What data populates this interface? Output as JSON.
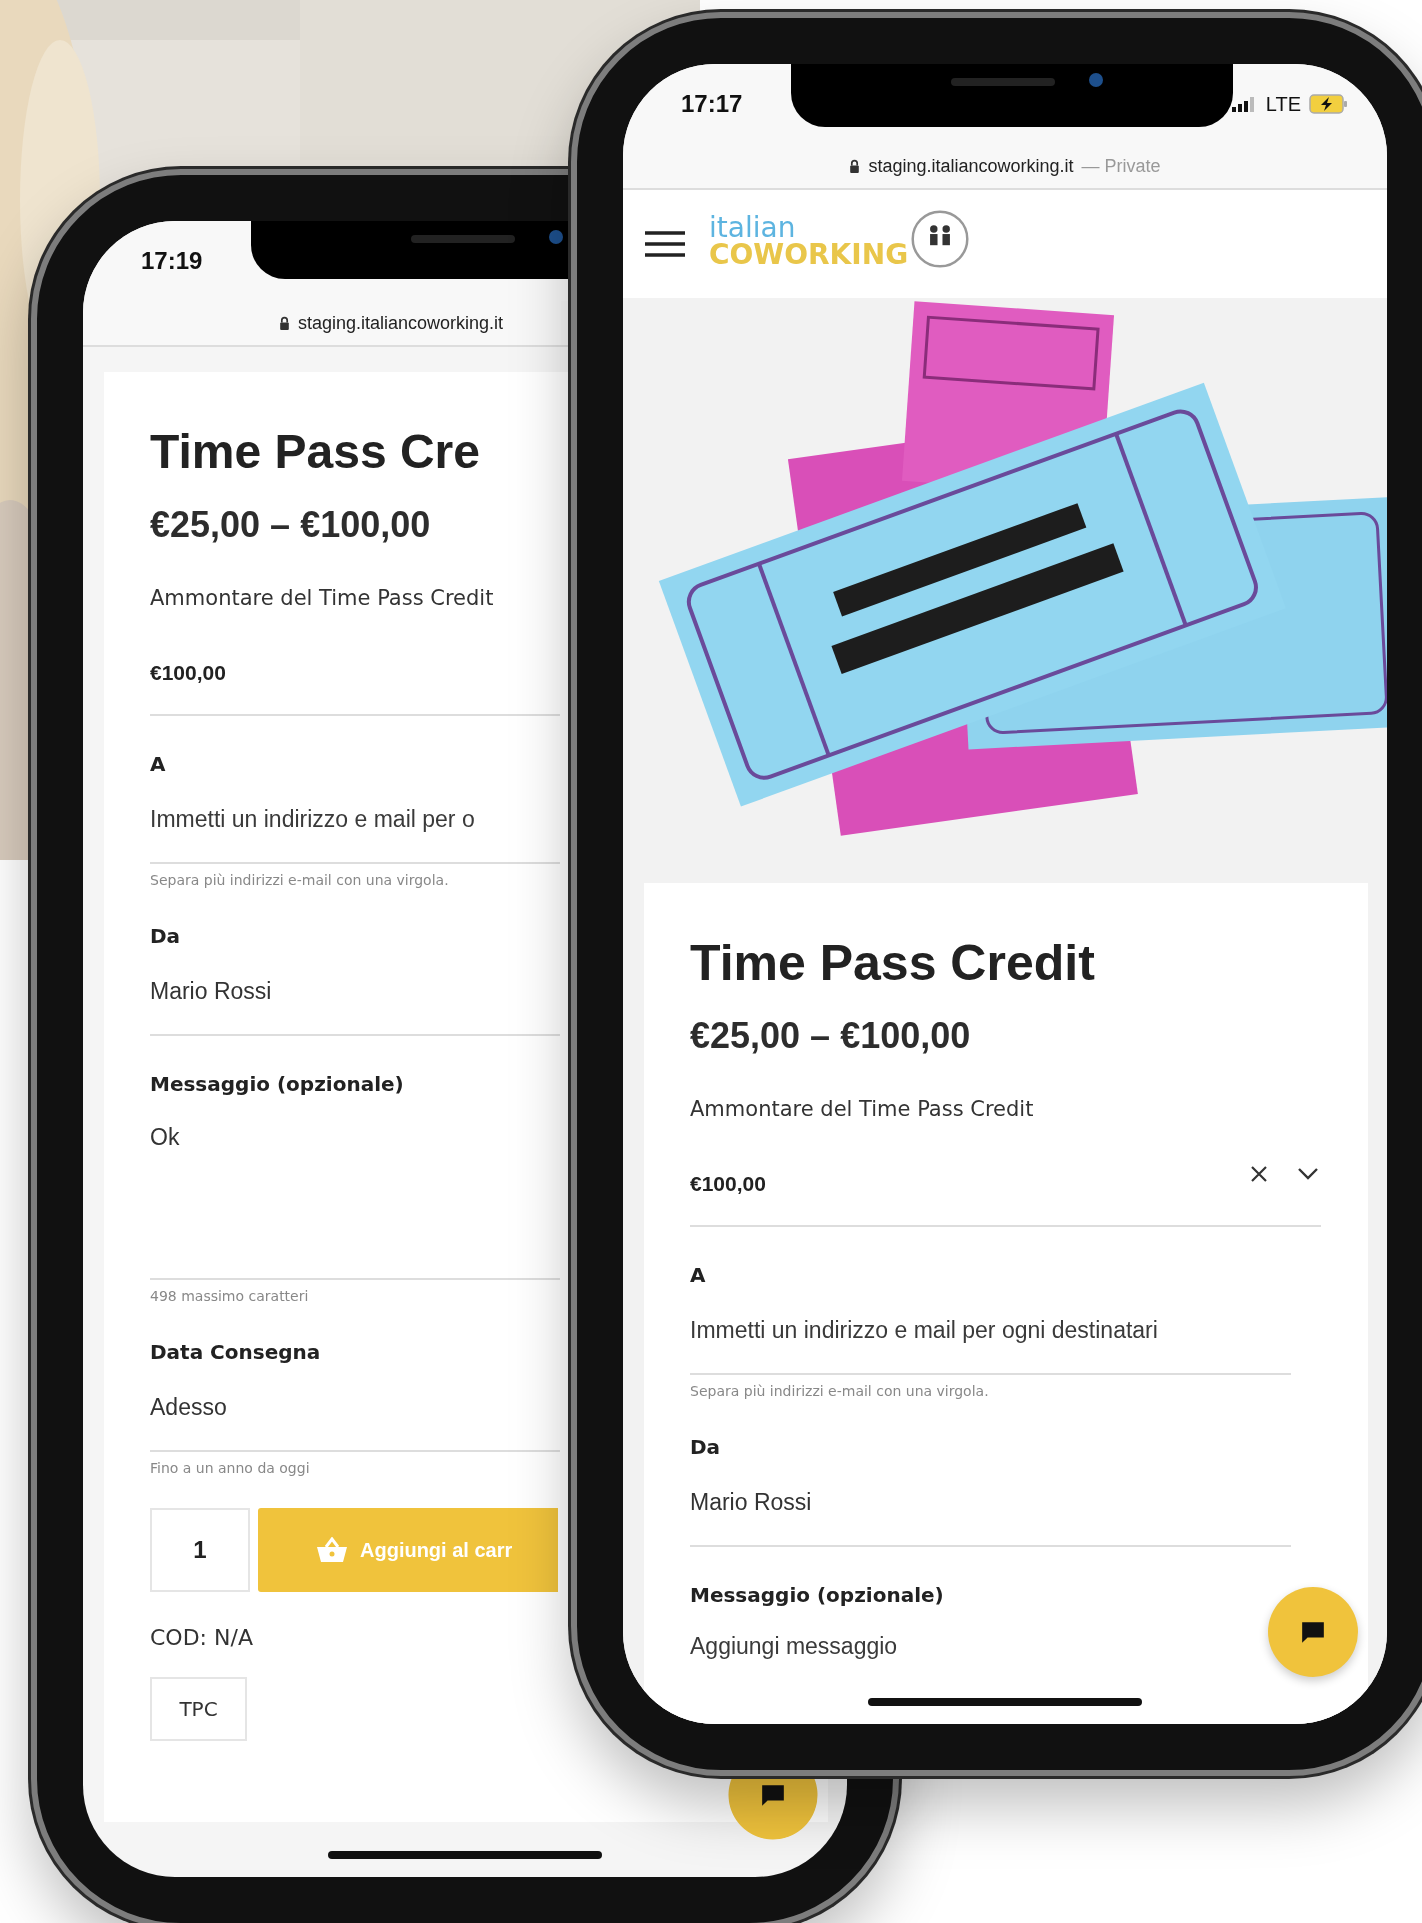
{
  "back_phone": {
    "status_time": "17:19",
    "address": "staging.italiancoworking.it",
    "product": {
      "title": "Time Pass Cre",
      "price": "€25,00 – €100,00",
      "fields": [
        {
          "kind": "select",
          "label": "Ammontare del Time Pass Credit",
          "value": "€100,00"
        },
        {
          "kind": "text",
          "label": "A",
          "placeholder": "Immetti un indirizzo e mail per o",
          "help": "Separa più indirizzi e-mail con una virgola."
        },
        {
          "kind": "text",
          "label": "Da",
          "value": "Mario Rossi"
        },
        {
          "kind": "textarea",
          "label": "Messaggio (opzionale)",
          "value": "Ok",
          "help": "498 massimo caratteri"
        },
        {
          "kind": "text",
          "label": "Data Consegna",
          "value": "Adesso",
          "help": "Fino a un anno da oggi"
        }
      ],
      "quantity": "1",
      "cart_button": "Aggiungi al carr",
      "sku": "COD: N/A",
      "tag": "TPC"
    }
  },
  "front_phone": {
    "status_time": "17:17",
    "network": "LTE",
    "address": "staging.italiancoworking.it",
    "address_note": "— Private",
    "logo": {
      "line_1": "italian",
      "line_2": "COWORKING"
    },
    "product": {
      "title": "Time Pass Credit",
      "price": "€25,00 – €100,00",
      "fields": [
        {
          "kind": "select",
          "label": "Ammontare del Time Pass Credit",
          "value": "€100,00",
          "clearable": true
        },
        {
          "kind": "text",
          "label": "A",
          "placeholder": "Immetti un indirizzo e mail per ogni destinatari",
          "help": "Separa più indirizzi e-mail con una virgola."
        },
        {
          "kind": "text",
          "label": "Da",
          "value": "Mario Rossi"
        },
        {
          "kind": "textarea",
          "label": "Messaggio (opzionale)",
          "placeholder": "Aggiungi messaggio"
        }
      ]
    }
  }
}
